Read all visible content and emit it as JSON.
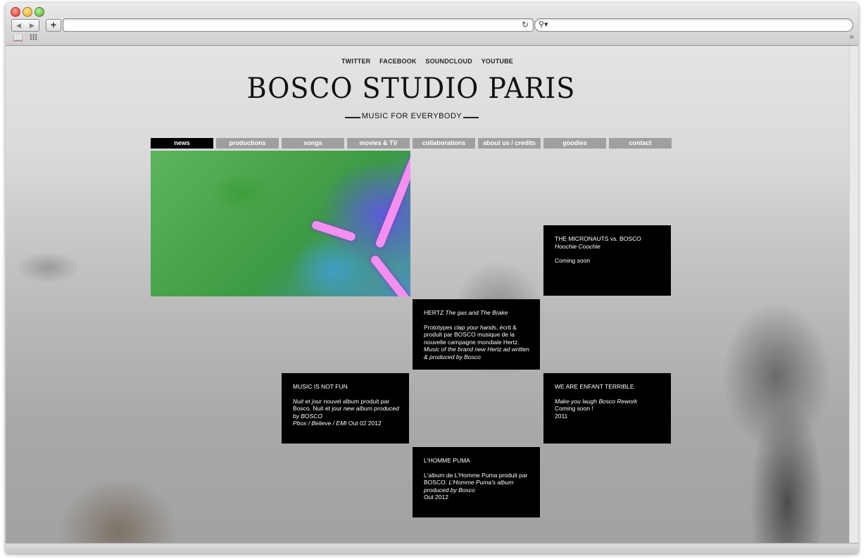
{
  "browser": {
    "url": "",
    "search_placeholder": "",
    "reload_icon": "↻",
    "more_icon": "»"
  },
  "site": {
    "social": [
      "TWITTER",
      "FACEBOOK",
      "SOUNDCLOUD",
      "YOUTUBE"
    ],
    "logo": "BOSCO STUDIO PARIS",
    "tagline": "MUSIC FOR EVERYBODY",
    "menu": [
      "news",
      "productions",
      "songs",
      "movies & TV",
      "collaborations",
      "about us / credits",
      "goodies",
      "contact"
    ],
    "active_menu": "news"
  },
  "cards": {
    "micronauts": {
      "title": "THE MICRONAUTS vs. BOSCO",
      "subtitle": "Hoochie Coochie",
      "status": "Coming soon"
    },
    "hertz": {
      "title_plain": "HERTZ ",
      "title_italic": "The gas and The Brake",
      "p1_a": "Prototypes ",
      "p1_b": "clap your hands",
      "p1_c": ", écrit & produit par BOSCO musique de la nouvelle campagne mondiale Hertz.",
      "p2": "Music of the brand new Hertz ad written & produced by Bosco"
    },
    "music_not_fun": {
      "title": "MUSIC IS NOT FUN",
      "l1_a": "Nuit et jour",
      "l1_b": " nouvel album produit par Bosco. Nuit et jour ",
      "l1_c": "new album produced by BOSCO",
      "l2_a": "Pbox / Believe / EMI",
      "l2_b": " Out 02 2012"
    },
    "enfant": {
      "title": "WE ARE ENFANT TERRIBLE",
      "l1": "Make you laugh Bosco Rework",
      "l2": "Coming soon !",
      "l3": "2011"
    },
    "puma": {
      "title": "L'HOMME PUMA",
      "l1_a": "L'album de L'Homme Puma produit par BOSCO. ",
      "l1_b": "L'Homme Puma's album produced by Bosco",
      "l2": "Out 2012"
    }
  }
}
